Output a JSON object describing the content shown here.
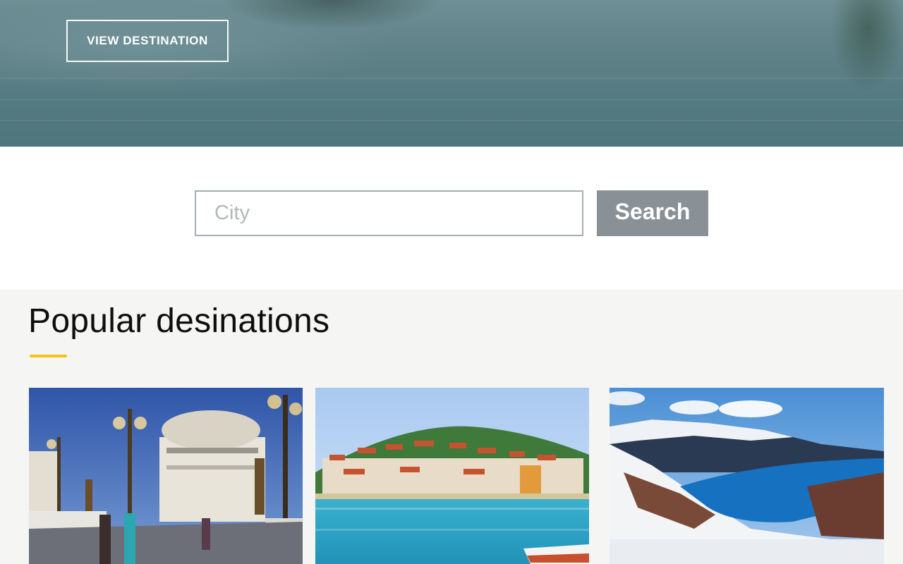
{
  "hero": {
    "button_label": "VIEW DESTINATION"
  },
  "search": {
    "placeholder": "City",
    "value": "",
    "button_label": "Search"
  },
  "popular": {
    "title": "Popular desinations",
    "accent_color": "#f3c316",
    "cards": [
      {
        "image": "skopje-square-photo"
      },
      {
        "image": "ohrid-lake-town-photo"
      },
      {
        "image": "mavrovo-snowy-lake-photo"
      }
    ]
  },
  "colors": {
    "search_button_bg": "#8a9196",
    "input_border": "#a7aeb2",
    "section_bg": "#f5f5f4"
  }
}
